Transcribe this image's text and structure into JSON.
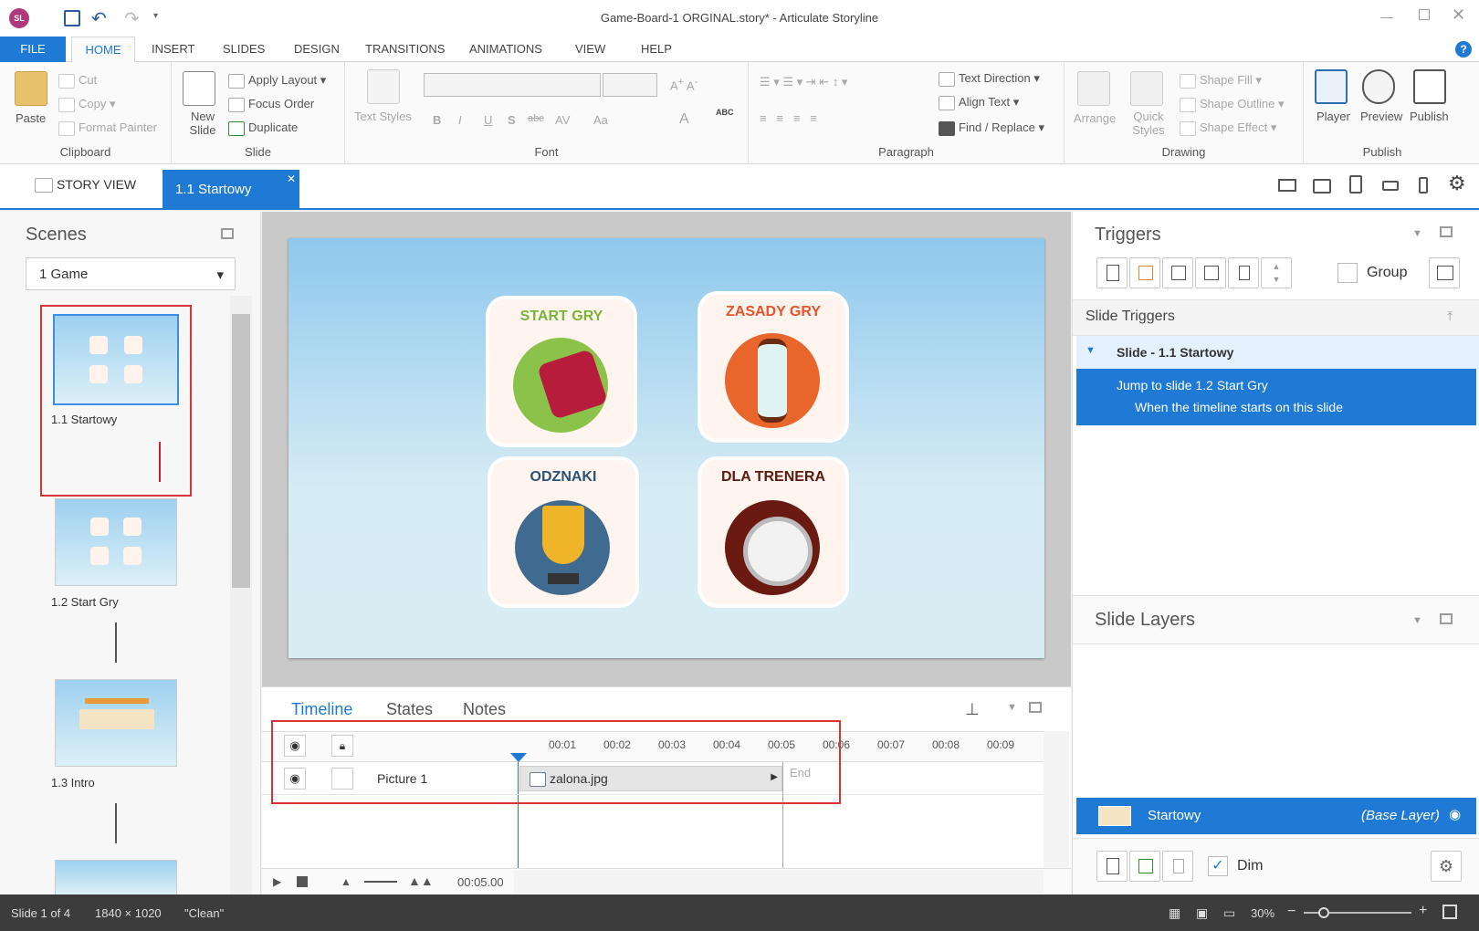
{
  "window": {
    "title": "Game-Board-1 ORGINAL.story* -  Articulate Storyline",
    "app_badge": "SL"
  },
  "menu": {
    "file": "FILE",
    "home": "HOME",
    "insert": "INSERT",
    "slides": "SLIDES",
    "design": "DESIGN",
    "transitions": "TRANSITIONS",
    "animations": "ANIMATIONS",
    "view": "VIEW",
    "help": "HELP"
  },
  "ribbon": {
    "clipboard": {
      "label": "Clipboard",
      "paste": "Paste",
      "cut": "Cut",
      "copy": "Copy",
      "format_painter": "Format Painter"
    },
    "slide": {
      "label": "Slide",
      "new_slide": "New Slide",
      "apply_layout": "Apply Layout",
      "focus_order": "Focus Order",
      "duplicate": "Duplicate"
    },
    "font": {
      "label": "Font",
      "text_styles": "Text Styles",
      "bold": "B",
      "italic": "I",
      "underline": "U",
      "shadow": "S",
      "strike": "abc",
      "spacing": "AV",
      "case": "Aa",
      "color": "A",
      "spell": "ABC"
    },
    "paragraph": {
      "label": "Paragraph",
      "text_direction": "Text Direction",
      "align_text": "Align Text",
      "find_replace": "Find / Replace"
    },
    "drawing": {
      "label": "Drawing",
      "arrange": "Arrange",
      "quick_styles": "Quick Styles",
      "shape_fill": "Shape Fill",
      "shape_outline": "Shape Outline",
      "shape_effect": "Shape Effect"
    },
    "publish": {
      "label": "Publish",
      "player": "Player",
      "preview": "Preview",
      "publish": "Publish"
    }
  },
  "tabs": {
    "story_view": "STORY VIEW",
    "slide_tab": "1.1 Startowy"
  },
  "scenes": {
    "title": "Scenes",
    "selected": "1  Game",
    "slides": [
      {
        "label": "1.1 Startowy"
      },
      {
        "label": "1.2 Start Gry"
      },
      {
        "label": "1.3 Intro"
      }
    ]
  },
  "slide_content": {
    "tiles": [
      {
        "title": "START GRY",
        "color": "#8bc34a"
      },
      {
        "title": "ZASADY GRY",
        "color": "#e8532b"
      },
      {
        "title": "ODZNAKI",
        "color": "#2b5478"
      },
      {
        "title": "DLA TRENERA",
        "color": "#6b1a12"
      }
    ]
  },
  "timeline": {
    "tabs": {
      "timeline": "Timeline",
      "states": "States",
      "notes": "Notes"
    },
    "ticks": [
      "00:01",
      "00:02",
      "00:03",
      "00:04",
      "00:05",
      "00:06",
      "00:07",
      "00:08",
      "00:09"
    ],
    "row": {
      "name": "Picture 1",
      "media": "zalona.jpg"
    },
    "end_label": "End",
    "duration": "00:05.00"
  },
  "triggers": {
    "title": "Triggers",
    "group_label": "Group",
    "slide_triggers": "Slide Triggers",
    "slide_node": "Slide - 1.1 Startowy",
    "action": "Jump to slide 1.2 Start Gry",
    "condition": "When the timeline starts on this slide"
  },
  "layers": {
    "title": "Slide Layers",
    "base_name": "Startowy",
    "base_tag": "(Base Layer)",
    "dim": "Dim"
  },
  "status": {
    "slide": "Slide 1 of 4",
    "size": "1840 × 1020",
    "theme": "\"Clean\"",
    "zoom": "30%"
  }
}
